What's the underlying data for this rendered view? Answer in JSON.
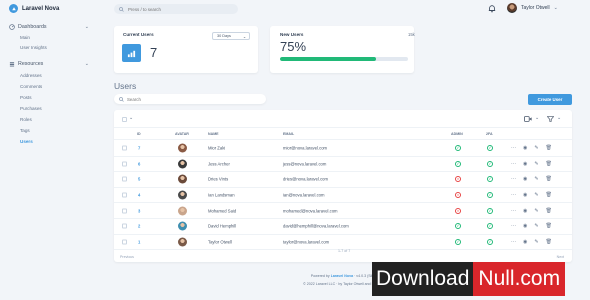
{
  "brand": {
    "name": "Laravel Nova"
  },
  "topbar": {
    "search_placeholder": "Press / to search",
    "user_name": "Taylor Otwell"
  },
  "sidebar": {
    "dashboards_label": "Dashboards",
    "dashboard_items": [
      "Main",
      "User Insights"
    ],
    "resources_label": "Resources",
    "resource_items": [
      "Addresses",
      "Comments",
      "Posts",
      "Purchases",
      "Roles",
      "Tags",
      "Users"
    ],
    "active_item": "Users"
  },
  "cards": {
    "current_users": {
      "title": "Current Users",
      "range": "30 Days",
      "value": "7"
    },
    "new_users": {
      "title": "New Users",
      "value": "75%",
      "total": "15k",
      "progress": 0.75
    }
  },
  "resource": {
    "title": "Users",
    "search_placeholder": "Search",
    "create_label": "Create User",
    "columns": [
      "ID",
      "AVATAR",
      "NAME",
      "EMAIL",
      "ADMIN",
      "2FA"
    ],
    "rows": [
      {
        "id": "7",
        "name": "Mior Zaki",
        "email": "mior@nova.laravel.com",
        "admin": true,
        "twofa": true,
        "avatar_color": "#8a5a44"
      },
      {
        "id": "6",
        "name": "Jess Archer",
        "email": "jess@nova.laravel.com",
        "admin": true,
        "twofa": true,
        "avatar_color": "#3a3a3a"
      },
      {
        "id": "5",
        "name": "Dries Vints",
        "email": "dries@nova.laravel.com",
        "admin": false,
        "twofa": true,
        "avatar_color": "#6b4a3a"
      },
      {
        "id": "4",
        "name": "Ian Landsman",
        "email": "ian@nova.laravel.com",
        "admin": false,
        "twofa": true,
        "avatar_color": "#4a4a4a"
      },
      {
        "id": "3",
        "name": "Mohamed Said",
        "email": "mohamed@nova.laravel.com",
        "admin": false,
        "twofa": true,
        "avatar_color": "#c9a58c"
      },
      {
        "id": "2",
        "name": "David Hemphill",
        "email": "david@hemphill@nova.laravel.com",
        "admin": true,
        "twofa": true,
        "avatar_color": "#3f8fb0"
      },
      {
        "id": "1",
        "name": "Taylor Otwell",
        "email": "taylor@nova.laravel.com",
        "admin": true,
        "twofa": true,
        "avatar_color": "#7a5a48"
      }
    ],
    "pagination": {
      "prev": "Previous",
      "count": "1-7 of 7",
      "next": "Next"
    }
  },
  "footer": {
    "line1_prefix": "Powered by",
    "line1_link": "Laravel Nova",
    "line1_suffix": "· v4.0.3 (Silver Surfer)",
    "line2": "© 2022 Laravel LLC · by Taylor Otwell and David Hemphill."
  },
  "watermark": {
    "part1": "Download",
    "part2": "Null.com"
  }
}
